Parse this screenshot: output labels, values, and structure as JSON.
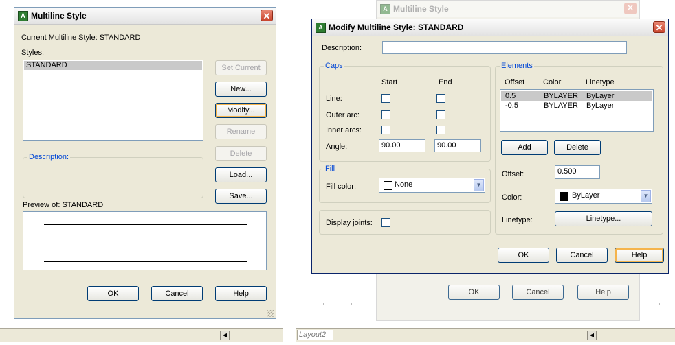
{
  "left_dialog": {
    "title": "Multiline Style",
    "current_style_label": "Current Multiline Style: STANDARD",
    "styles_label": "Styles:",
    "styles": [
      "STANDARD"
    ],
    "buttons": {
      "set_current": "Set Current",
      "new": "New...",
      "modify": "Modify...",
      "rename": "Rename",
      "delete": "Delete",
      "load": "Load...",
      "save": "Save...",
      "ok": "OK",
      "cancel": "Cancel",
      "help": "Help"
    },
    "description_label": "Description:",
    "preview_label": "Preview of: STANDARD"
  },
  "bg_dialog": {
    "title": "Multiline Style",
    "buttons": {
      "ok": "OK",
      "cancel": "Cancel",
      "help": "Help"
    }
  },
  "modify_dialog": {
    "title": "Modify Multiline Style: STANDARD",
    "description_label": "Description:",
    "description_value": "",
    "caps": {
      "group_label": "Caps",
      "start_header": "Start",
      "end_header": "End",
      "line_label": "Line:",
      "outer_arc_label": "Outer arc:",
      "inner_arcs_label": "Inner arcs:",
      "angle_label": "Angle:",
      "angle_start": "90.00",
      "angle_end": "90.00"
    },
    "fill": {
      "group_label": "Fill",
      "fill_color_label": "Fill color:",
      "fill_color_value": "None"
    },
    "display_joints_label": "Display joints:",
    "elements": {
      "group_label": "Elements",
      "columns": [
        "Offset",
        "Color",
        "Linetype"
      ],
      "rows": [
        {
          "offset": "0.5",
          "color": "BYLAYER",
          "linetype": "ByLayer"
        },
        {
          "offset": "-0.5",
          "color": "BYLAYER",
          "linetype": "ByLayer"
        }
      ],
      "add_label": "Add",
      "delete_label": "Delete",
      "offset_label": "Offset:",
      "offset_value": "0.500",
      "color_label": "Color:",
      "color_value": "ByLayer",
      "linetype_label": "Linetype:",
      "linetype_button": "Linetype..."
    },
    "buttons": {
      "ok": "OK",
      "cancel": "Cancel",
      "help": "Help"
    }
  },
  "taskbar": {
    "layout_tab": "Layout2",
    "scroll_left_icon": "chevron-left-icon"
  },
  "colors": {
    "dialog_bg": "#ece9d8",
    "group_label": "#0046d5",
    "close_button": "#c9452e",
    "selection": "#c9c9c9"
  }
}
